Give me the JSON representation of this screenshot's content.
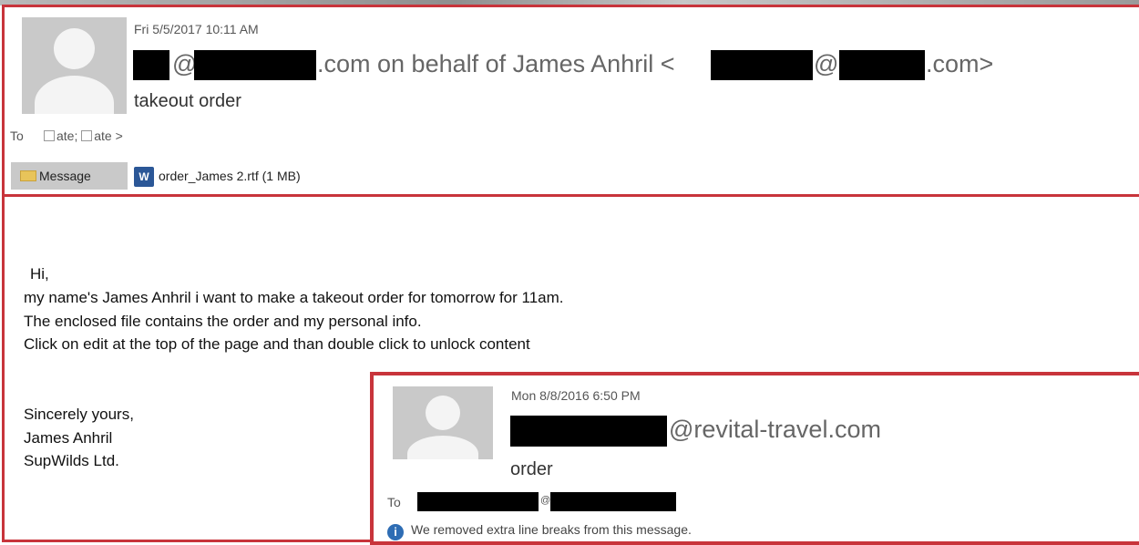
{
  "email": {
    "date": "Fri 5/5/2017 10:11 AM",
    "sender_at": "@",
    "sender_domain_suffix": ".com",
    "sender_behalf": " on behalf of James Anhril <",
    "sender_at2": "@",
    "sender_end": ".com>",
    "subject": "takeout order",
    "to_label": "To",
    "recipient1": "ate;",
    "recipient2": "ate >",
    "message_tab_label": "Message",
    "attachment_icon": "word-document-icon",
    "attachment_label": "order_James 2.rtf (1 MB)",
    "body": {
      "greeting": "Hi,",
      "line1": "my name's  James Anhril i want to make a takeout order for tomorrow for 11am.",
      "line2": "The enclosed file contains the order and my personal info.",
      "line3": "Click on edit at the top of the page and than double click  to unlock content",
      "closing": "Sincerely yours,",
      "sig_name": "James Anhril",
      "sig_company": "SupWilds Ltd."
    }
  },
  "inner_email": {
    "date": "Mon 8/8/2016 6:50 PM",
    "sender_domain": "@revital-travel.com",
    "subject": "order",
    "to_label": "To",
    "to_at": "@",
    "notice_icon": "info-icon",
    "notice": "We removed extra line breaks from this message."
  },
  "colors": {
    "frame_red": "#c8343b",
    "redaction": "#000000",
    "info_blue": "#2e6db4"
  }
}
